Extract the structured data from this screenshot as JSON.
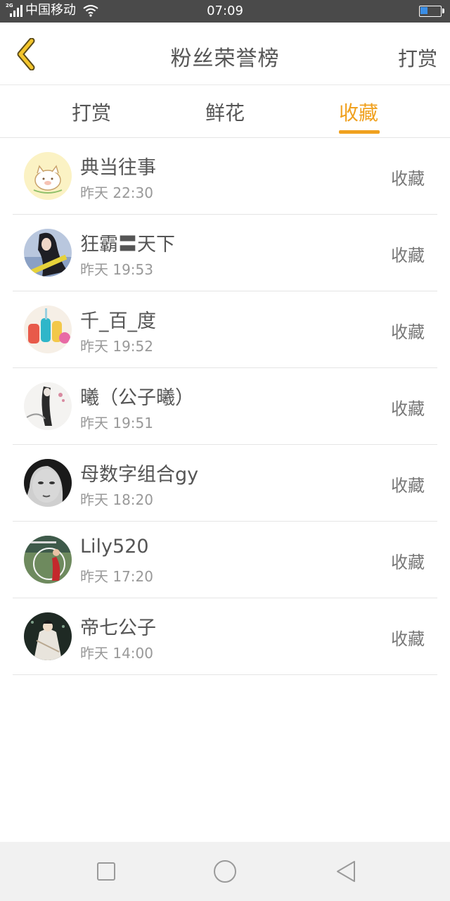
{
  "status_bar": {
    "network_tag": "2G",
    "carrier": "中国移动",
    "time": "07:09",
    "battery_level": 0.4,
    "battery_color": "#3a8ee6"
  },
  "header": {
    "back_icon": "chevron-left-icon",
    "title": "粉丝荣誉榜",
    "action_label": "打赏"
  },
  "tabs": {
    "items": [
      {
        "label": "打赏",
        "active": false
      },
      {
        "label": "鲜花",
        "active": false
      },
      {
        "label": "收藏",
        "active": true
      }
    ],
    "accent_color": "#f0a11f"
  },
  "fans": [
    {
      "name": "典当往事",
      "time": "昨天 22:30",
      "action": "收藏",
      "avatar": "cartoon-pig-avatar"
    },
    {
      "name": "狂霸〓天下",
      "time": "昨天 19:53",
      "action": "收藏",
      "avatar": "girl-long-hair-avatar"
    },
    {
      "name": "千_百_度",
      "time": "昨天 19:52",
      "action": "收藏",
      "avatar": "colorful-toys-avatar"
    },
    {
      "name": "曦（公子曦）",
      "time": "昨天 19:51",
      "action": "收藏",
      "avatar": "ink-painting-avatar"
    },
    {
      "name": "母数字组合gy",
      "time": "昨天 18:20",
      "action": "收藏",
      "avatar": "grayscale-face-avatar"
    },
    {
      "name": "Lily520",
      "time": "昨天 17:20",
      "action": "收藏",
      "avatar": "red-dress-girl-avatar"
    },
    {
      "name": "帝七公子",
      "time": "昨天 14:00",
      "action": "收藏",
      "avatar": "ancient-warrior-avatar"
    }
  ],
  "nav_bar": {
    "buttons": [
      "recents-square-icon",
      "home-circle-icon",
      "back-triangle-icon"
    ]
  }
}
